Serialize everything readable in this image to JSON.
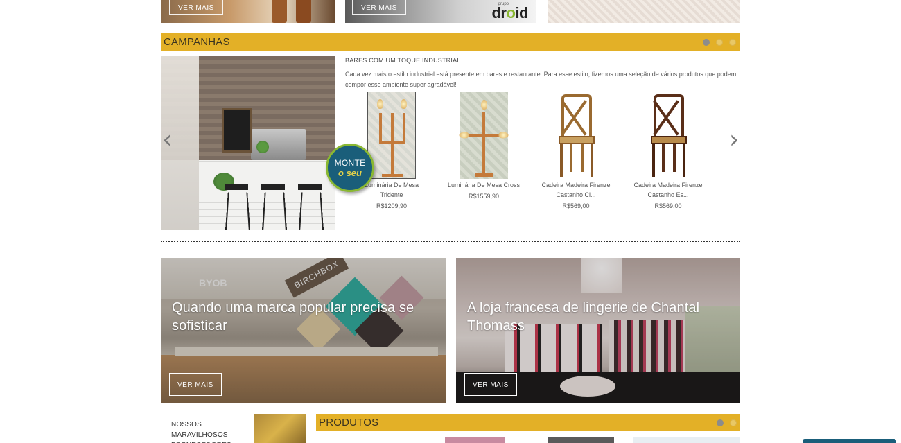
{
  "top_banners": {
    "ver_mais_1": "VER MAIS",
    "ver_mais_2": "VER MAIS",
    "brand_small": "grupo",
    "brand_logo_pre": "dr",
    "brand_logo_o": "o",
    "brand_logo_post": "id"
  },
  "campanhas": {
    "title": "CAMPANHAS",
    "slide_indicator": {
      "current": 1,
      "total": 3
    },
    "headline": "BARES COM UM TOQUE INDUSTRIAL",
    "description": "Cada vez mais o estilo industrial está presente em bares e restaurante. Para esse estilo, fizemos uma seleção de vários produtos que podem compor esse ambiente super agradável!",
    "badge_line1": "MONTE",
    "badge_line2": "o seu",
    "prev_arrow": "‹",
    "next_arrow": "›",
    "products": [
      {
        "name": "Luminária De Mesa Tridente",
        "price": "R$1209,90"
      },
      {
        "name": "Luminária De Mesa Cross",
        "price": "R$1559,90"
      },
      {
        "name": "Cadeira Madeira Firenze Castanho Cl...",
        "price": "R$569,00"
      },
      {
        "name": "Cadeira Madeira Firenze Castanho Es...",
        "price": "R$569,00"
      }
    ]
  },
  "stories": [
    {
      "headline": "Quando uma marca popular precisa se sofisticar",
      "button": "VER MAIS",
      "sign": "BIRCHBOX",
      "sign2": "BYOB"
    },
    {
      "headline": "A loja francesa de lingerie de Chantal Thomass",
      "button": "VER MAIS"
    }
  ],
  "fornecedores": {
    "label": "NOSSOS MARAVILHOSOS FORNECEDORES"
  },
  "produtos": {
    "title": "PRODUTOS",
    "slide_indicator": {
      "current": 1,
      "total": 2
    }
  },
  "colors": {
    "accent_bar": "#e3b027",
    "badge_blue": "#1a5e7a",
    "badge_green": "#8ab832"
  }
}
